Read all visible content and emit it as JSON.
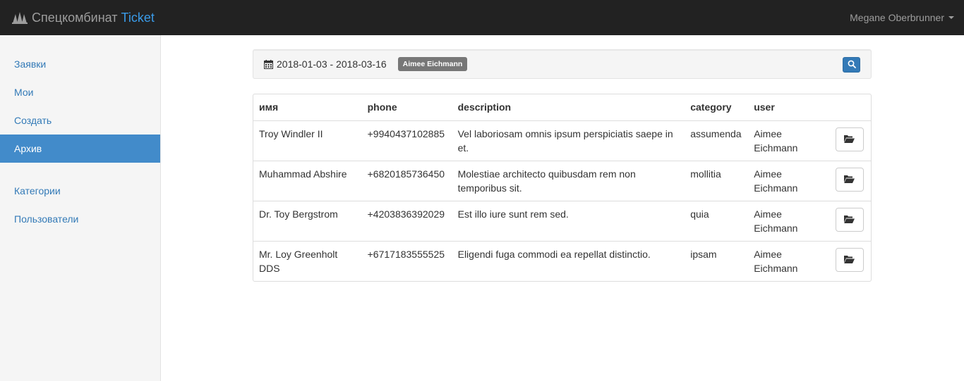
{
  "navbar": {
    "brand_name": "Спецкомбинат",
    "brand_accent": "Ticket",
    "user_name": "Megane Oberbrunner"
  },
  "sidebar": {
    "items": [
      {
        "label": "Заявки"
      },
      {
        "label": "Мои"
      },
      {
        "label": "Создать"
      },
      {
        "label": "Архив",
        "active": true
      },
      {
        "label": "Категории"
      },
      {
        "label": "Пользователи"
      }
    ]
  },
  "filter": {
    "date_range": "2018-01-03 - 2018-03-16",
    "user_badge": "Aimee Eichmann"
  },
  "table": {
    "headers": {
      "name": "имя",
      "phone": "phone",
      "description": "description",
      "category": "category",
      "user": "user"
    },
    "rows": [
      {
        "name": "Troy Windler II",
        "phone": "+9940437102885",
        "description": "Vel laboriosam omnis ipsum perspiciatis saepe in et.",
        "category": "assumenda",
        "user": "Aimee Eichmann"
      },
      {
        "name": "Muhammad Abshire",
        "phone": "+6820185736450",
        "description": "Molestiae architecto quibusdam rem non temporibus sit.",
        "category": "mollitia",
        "user": "Aimee Eichmann"
      },
      {
        "name": "Dr. Toy Bergstrom",
        "phone": "+4203836392029",
        "description": "Est illo iure sunt rem sed.",
        "category": "quia",
        "user": "Aimee Eichmann"
      },
      {
        "name": "Mr. Loy Greenholt DDS",
        "phone": "+6717183555525",
        "description": "Eligendi fuga commodi ea repellat distinctio.",
        "category": "ipsam",
        "user": "Aimee Eichmann"
      }
    ]
  },
  "icons": {
    "logo": "building-icon",
    "calendar": "calendar-icon",
    "search": "search-icon",
    "open": "folder-open-icon"
  },
  "colors": {
    "navbar_bg": "#222222",
    "brand_accent": "#3a9be8",
    "link": "#337ab7",
    "active_item": "#428bca",
    "badge": "#777777",
    "search_button": "#337ab7"
  }
}
